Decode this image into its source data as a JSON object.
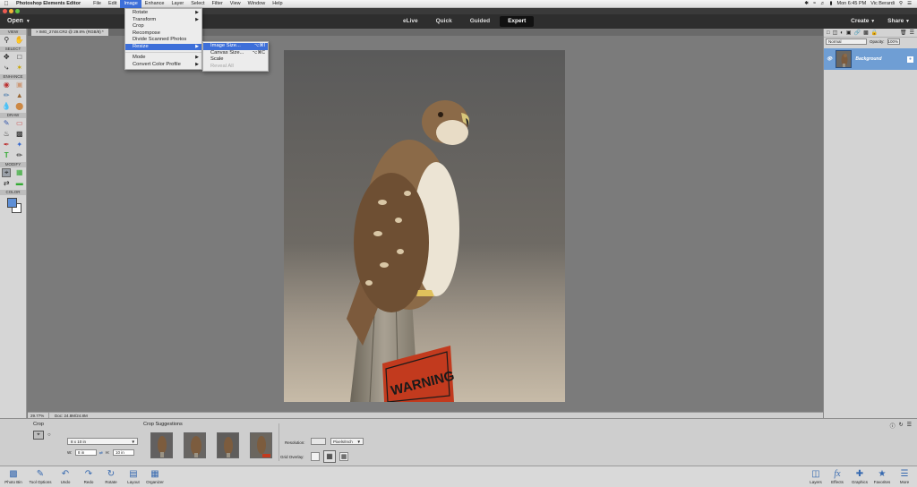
{
  "menubar": {
    "apple": "",
    "app": "Photoshop Elements Editor",
    "items": [
      "File",
      "Edit",
      "Image",
      "Enhance",
      "Layer",
      "Select",
      "Filter",
      "View",
      "Window",
      "Help"
    ],
    "active_index": 2,
    "clock": "Mon 6:45 PM",
    "user": "Vic Berardi"
  },
  "modebar": {
    "open": "Open",
    "modes": [
      "eLive",
      "Quick",
      "Guided",
      "Expert"
    ],
    "selected_mode": "Expert",
    "create": "Create",
    "share": "Share"
  },
  "toolbox": {
    "sections": [
      "VIEW",
      "SELECT",
      "ENHANCE",
      "DRAW",
      "MODIFY",
      "COLOR"
    ],
    "colors": {
      "foreground": "#5e8fd6",
      "background": "#ffffff"
    }
  },
  "document": {
    "tab": "IMG_2748.CR2 @ 29.8% (RGB/8) *",
    "zoom": "29.77%",
    "doc_info": "Doc: 24.8M/24.8M",
    "photo_sign": "WARNING"
  },
  "image_menu": {
    "items": [
      {
        "label": "Rotate",
        "submenu": true
      },
      {
        "label": "Transform",
        "submenu": true
      },
      {
        "label": "Crop"
      },
      {
        "label": "Recompose"
      },
      {
        "label": "Divide Scanned Photos"
      },
      {
        "label": "Resize",
        "submenu": true,
        "highlighted": true
      },
      {
        "label": "Mode",
        "submenu": true
      },
      {
        "label": "Convert Color Profile",
        "submenu": true
      }
    ]
  },
  "resize_menu": {
    "items": [
      {
        "label": "Image Size...",
        "shortcut": "⌥⌘I",
        "highlighted": true
      },
      {
        "label": "Canvas Size...",
        "shortcut": "⌥⌘C"
      },
      {
        "label": "Scale"
      },
      {
        "label": "Reveal All",
        "disabled": true
      }
    ]
  },
  "layers": {
    "blend_mode": "Normal",
    "opacity_label": "Opacity:",
    "opacity": "100%",
    "layer_name": "Background"
  },
  "tool_options": {
    "title": "Crop",
    "preset": "8 x 10 in",
    "w_label": "W:",
    "h_label": "H:",
    "width": "8 in",
    "height": "10 in",
    "suggestions_title": "Crop Suggestions",
    "resolution_label": "Resolution:",
    "resolution_value": "",
    "resolution_unit": "Pixels/Inch",
    "grid_overlay_label": "Grid Overlay:"
  },
  "bottombar": {
    "left": [
      "Photo Bin",
      "Tool Options",
      "Undo",
      "Redo",
      "Rotate",
      "Layout",
      "Organizer"
    ],
    "right": [
      "Layers",
      "Effects",
      "Graphics",
      "Favorites",
      "More"
    ]
  },
  "accent_colors": {
    "menu_highlight": "#3d6fd9",
    "layer_selected": "#6f9ed4",
    "mode_selected": "#111111"
  }
}
